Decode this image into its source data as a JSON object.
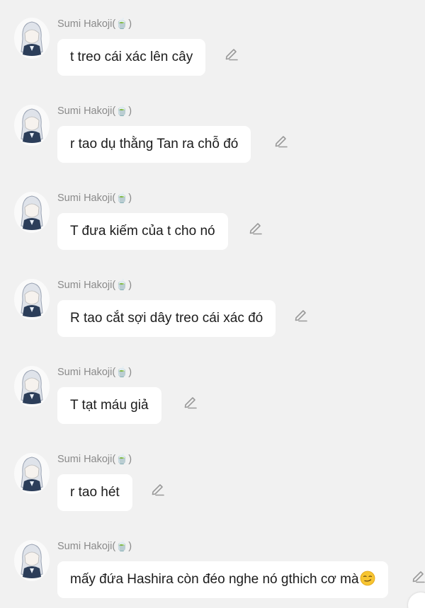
{
  "chat": {
    "messages": [
      {
        "sender": "Sumi Hakoji(🍵)",
        "text": "t treo cái xác lên cây",
        "emoji": "",
        "avatar_icon": "anime-avatar-icon",
        "edit_icon": "pencil-icon"
      },
      {
        "sender": "Sumi Hakoji(🍵)",
        "text": "r tao dụ thằng Tan ra chỗ đó",
        "emoji": "",
        "avatar_icon": "anime-avatar-icon",
        "edit_icon": "pencil-icon"
      },
      {
        "sender": "Sumi Hakoji(🍵)",
        "text": "T đưa kiếm của t cho nó",
        "emoji": "",
        "avatar_icon": "anime-avatar-icon",
        "edit_icon": "pencil-icon"
      },
      {
        "sender": "Sumi Hakoji(🍵)",
        "text": "R tao cắt sợi dây treo cái xác đó",
        "emoji": "",
        "avatar_icon": "anime-avatar-icon",
        "edit_icon": "pencil-icon"
      },
      {
        "sender": "Sumi Hakoji(🍵)",
        "text": "T tạt máu giả",
        "emoji": "",
        "avatar_icon": "anime-avatar-icon",
        "edit_icon": "pencil-icon"
      },
      {
        "sender": "Sumi Hakoji(🍵)",
        "text": "r tao hét",
        "emoji": "",
        "avatar_icon": "anime-avatar-icon",
        "edit_icon": "pencil-icon"
      },
      {
        "sender": "Sumi Hakoji(🍵)",
        "text": "mấy đứa Hashira còn đéo nghe nó gthich cơ mà",
        "emoji": "smirking-face-emoji",
        "avatar_icon": "anime-avatar-icon",
        "edit_icon": "pencil-icon"
      }
    ]
  },
  "colors": {
    "background": "#f1f1f1",
    "bubble": "#ffffff",
    "sender_name": "#8a8a8a",
    "message_text": "#1c1c1c",
    "icon": "#9a9a9a"
  }
}
